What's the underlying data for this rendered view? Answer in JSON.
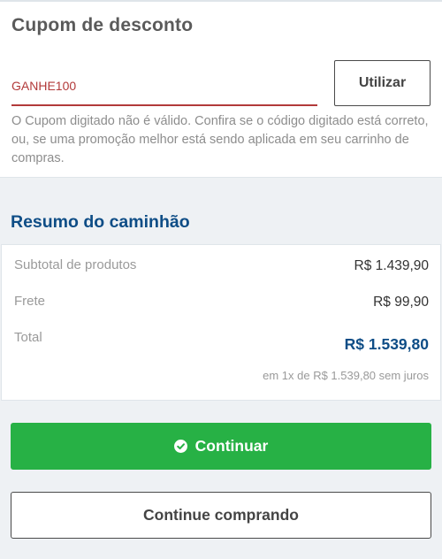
{
  "coupon": {
    "title": "Cupom de desconto",
    "input_value": "GANHE100",
    "apply_label": "Utilizar",
    "error_message": "O Cupom digitado não é válido. Confira se o código digitado está correto, ou, se uma promoção melhor está sendo aplicada em seu carrinho de compras."
  },
  "summary": {
    "title": "Resumo do caminhão",
    "subtotal_label": "Subtotal de produtos",
    "subtotal_value": "R$ 1.439,90",
    "shipping_label": "Frete",
    "shipping_value": "R$ 99,90",
    "total_label": "Total",
    "total_value": "R$ 1.539,80",
    "installments": "em 1x de R$ 1.539,80 sem juros"
  },
  "actions": {
    "continue_label": "Continuar",
    "continue_icon": "check-circle-icon",
    "keep_shopping_label": "Continue comprando"
  },
  "colors": {
    "accent_blue": "#0e4d86",
    "success_green": "#27b145",
    "error_red": "#b23a3a"
  }
}
